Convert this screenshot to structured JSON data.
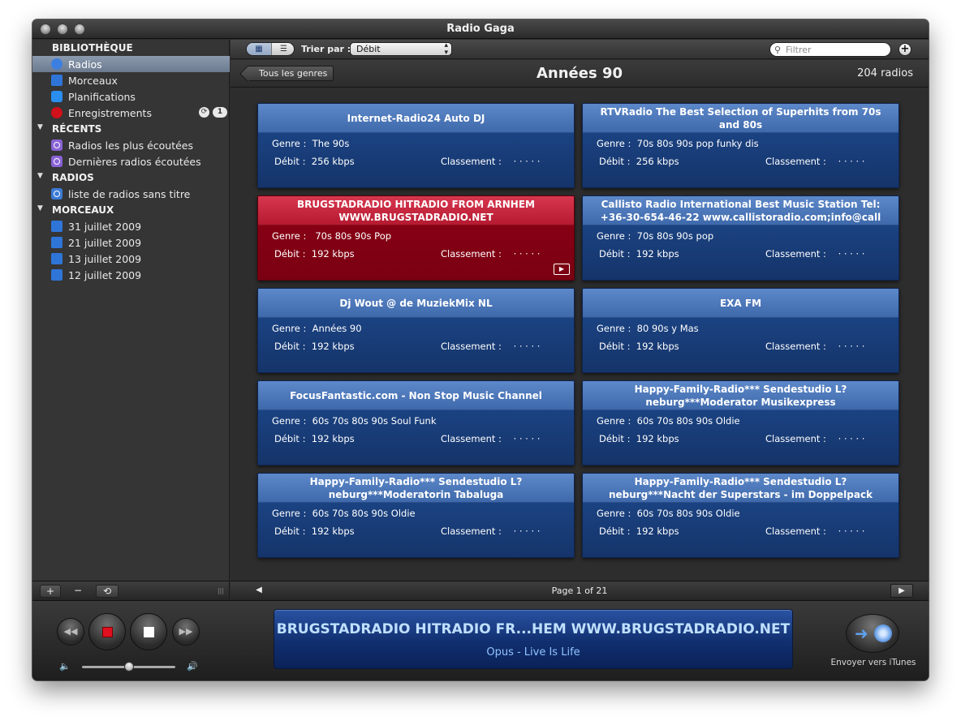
{
  "window": {
    "title": "Radio Gaga"
  },
  "sidebar": {
    "sections": [
      {
        "label": "BIBLIOTHÈQUE",
        "collapsible": false
      },
      {
        "label": "RÉCENTS",
        "collapsible": true
      },
      {
        "label": "RADIOS",
        "collapsible": true
      },
      {
        "label": "MORCEAUX",
        "collapsible": true
      }
    ],
    "library_items": [
      {
        "label": "Radios",
        "icon": "radio-icon",
        "selected": true
      },
      {
        "label": "Morceaux",
        "icon": "music-note-icon",
        "selected": false
      },
      {
        "label": "Planifications",
        "icon": "calendar-check-icon",
        "selected": false
      },
      {
        "label": "Enregistrements",
        "icon": "record-icon",
        "selected": false
      }
    ],
    "recordings_badge": "1",
    "recent_items": [
      {
        "label": "Radios les plus écoutées",
        "icon": "podcast-icon"
      },
      {
        "label": "Dernières radios écoutées",
        "icon": "podcast-icon"
      }
    ],
    "radio_items": [
      {
        "label": "liste de radios sans titre",
        "icon": "radio-list-icon"
      }
    ],
    "track_items": [
      {
        "label": "31 juillet 2009",
        "icon": "track-file-icon"
      },
      {
        "label": "21 juillet 2009",
        "icon": "track-file-icon"
      },
      {
        "label": "13 juillet 2009",
        "icon": "track-file-icon"
      },
      {
        "label": "12 juillet 2009",
        "icon": "track-file-icon"
      }
    ],
    "bottom_buttons": {
      "add": "+",
      "remove": "−",
      "repeat": "⟲",
      "resize": "|||"
    }
  },
  "toolbar": {
    "sort_label": "Trier par :",
    "sort_value": "Débit",
    "search_placeholder": "Filtrer",
    "add_label": "+"
  },
  "genre_bar": {
    "back_label": "Tous les genres",
    "title": "Années 90",
    "count": "204 radios"
  },
  "card_labels": {
    "genre": "Genre :",
    "debit": "Débit :",
    "rating": "Classement :",
    "rating_dots": "· · · · ·"
  },
  "cards": [
    {
      "title": "Internet-Radio24 Auto DJ",
      "genre": "The 90s",
      "bitrate": "256 kbps",
      "active": false
    },
    {
      "title": "RTVRadio The Best Selection of Superhits from 70s and 80s",
      "genre": "70s 80s 90s pop funky dis",
      "bitrate": "256 kbps",
      "active": false
    },
    {
      "title": "BRUGSTADRADIO HITRADIO FROM ARNHEM WWW.BRUGSTADRADIO.NET",
      "genre": " 70s  80s  90s Pop",
      "bitrate": "192 kbps",
      "active": true
    },
    {
      "title": "Callisto Radio International Best Music Station Tel: +36-30-654-46-22 www.callistoradio.com;info@call",
      "genre": "70s 80s 90s pop",
      "bitrate": "192 kbps",
      "active": false
    },
    {
      "title": "Dj Wout @ de MuziekMix NL",
      "genre": "Années 90",
      "bitrate": "192 kbps",
      "active": false
    },
    {
      "title": "EXA FM",
      "genre": "80  90s y Mas",
      "bitrate": "192 kbps",
      "active": false
    },
    {
      "title": "FocusFantastic.com - Non Stop Music Channel",
      "genre": "60s 70s 80s 90s Soul Funk",
      "bitrate": "192 kbps",
      "active": false
    },
    {
      "title": "Happy-Family-Radio*** Sendestudio L?neburg***Moderator Musikexpress",
      "genre": "60s  70s  80s  90s  Oldie",
      "bitrate": "192 kbps",
      "active": false
    },
    {
      "title": "Happy-Family-Radio*** Sendestudio L?neburg***Moderatorin Tabaluga",
      "genre": "60s  70s  80s  90s  Oldie",
      "bitrate": "192 kbps",
      "active": false
    },
    {
      "title": "Happy-Family-Radio*** Sendestudio L?neburg***Nacht der Superstars - im Doppelpack",
      "genre": "60s  70s  80s  90s  Oldie",
      "bitrate": "192 kbps",
      "active": false
    }
  ],
  "pager": {
    "text": "Page 1 of 21",
    "prev": "◀",
    "next": "▶"
  },
  "player": {
    "now_playing_station": "BRUGSTADRADIO HITRADIO FR...HEM WWW.BRUGSTADRADIO.NET",
    "now_playing_track": "Opus - Live Is Life",
    "rewind": "◀◀",
    "forward": "▶▶",
    "volume": 0.5,
    "send_to_itunes_label": "Envoyer vers iTunes",
    "colors": {
      "record": "#e01020",
      "stop": "#ffffff",
      "lcd_text": "#bfe0ff"
    }
  }
}
